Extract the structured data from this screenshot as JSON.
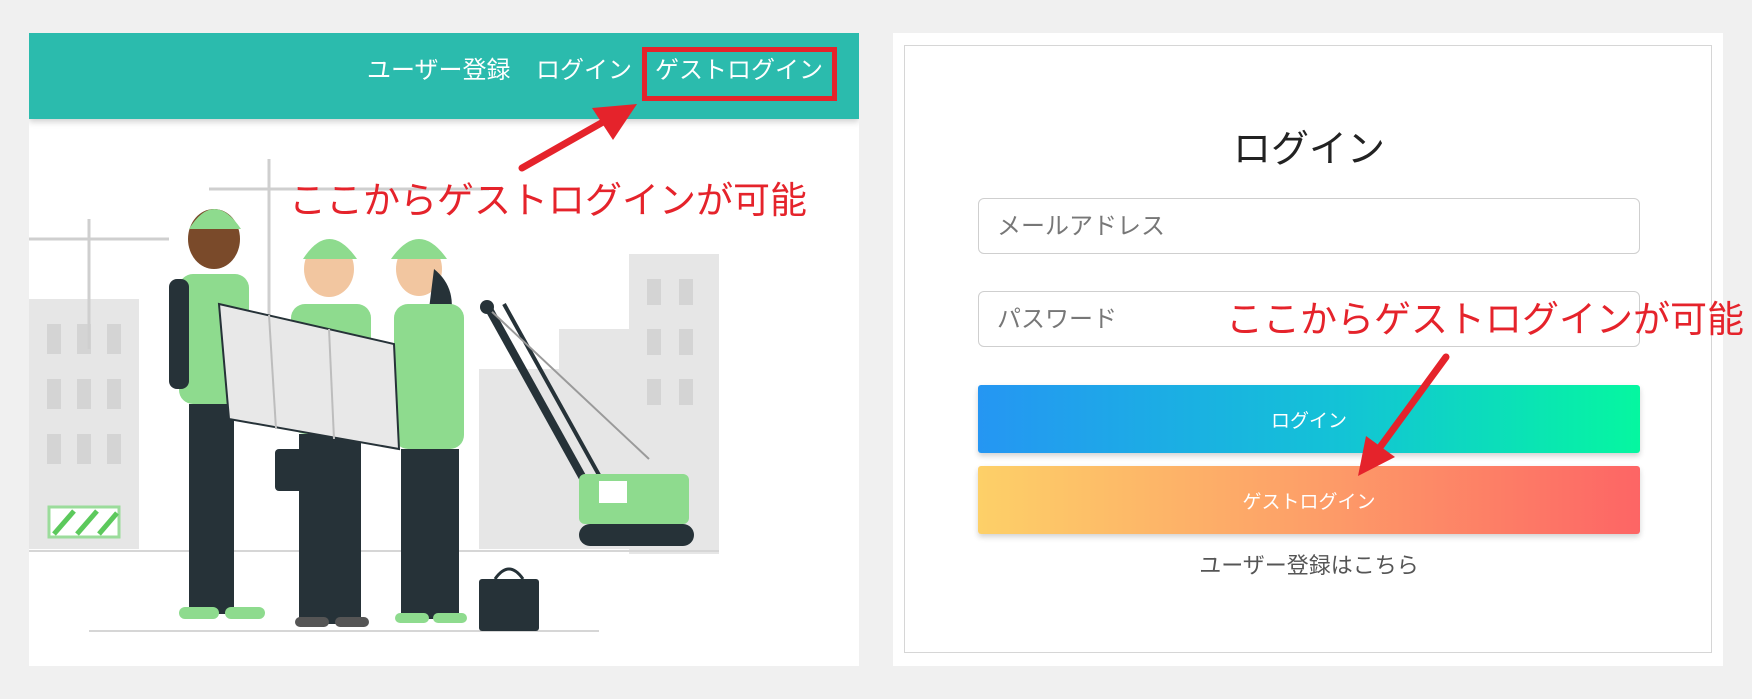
{
  "navbar": {
    "background": "#2bbbad",
    "links": {
      "register": "ユーザー登録",
      "login": "ログイン",
      "guest_login": "ゲストログイン"
    }
  },
  "annotations": {
    "color": "#e5232b",
    "left_note": "ここからゲストログインが可能",
    "right_note": "ここからゲストログインが可能"
  },
  "illustration": {
    "description_icon": "construction-workers-illustration"
  },
  "login_form": {
    "title": "ログイン",
    "email_placeholder": "メールアドレス",
    "password_placeholder": "パスワード",
    "login_button": "ログイン",
    "guest_button": "ゲストログイン",
    "register_link": "ユーザー登録はこちら"
  }
}
